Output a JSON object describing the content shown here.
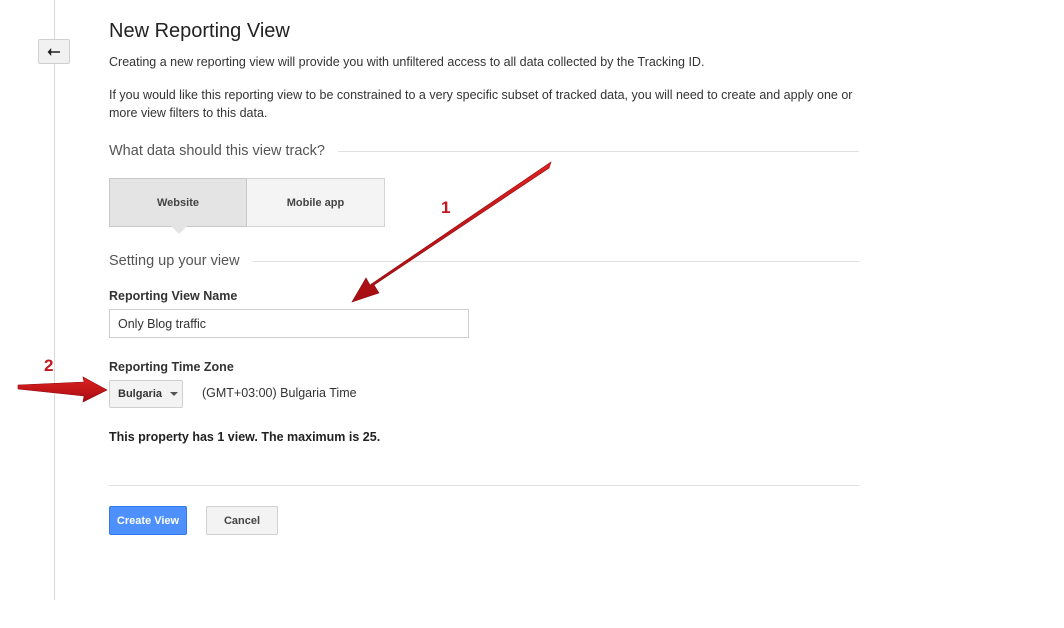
{
  "page": {
    "title": "New Reporting View",
    "description_1": "Creating a new reporting view will provide you with unfiltered access to all data collected by the Tracking ID.",
    "description_2": "If you would like this reporting view to be constrained to a very specific subset of tracked data, you will need to create and apply one or more view filters to this data."
  },
  "track_section": {
    "heading": "What data should this view track?",
    "options": [
      {
        "label": "Website",
        "selected": true
      },
      {
        "label": "Mobile app",
        "selected": false
      }
    ]
  },
  "setup_section": {
    "heading": "Setting up your view",
    "name_label": "Reporting View Name",
    "name_value": "Only Blog traffic",
    "timezone_label": "Reporting Time Zone",
    "timezone_country": "Bulgaria",
    "timezone_value": "(GMT+03:00) Bulgaria Time",
    "view_limit_text": "This property has 1 view. The maximum is 25."
  },
  "actions": {
    "create_label": "Create View",
    "cancel_label": "Cancel"
  },
  "annotations": {
    "marker_1": "1",
    "marker_2": "2",
    "color": "#c4161c"
  },
  "icons": {
    "back": "back-arrow-icon"
  }
}
